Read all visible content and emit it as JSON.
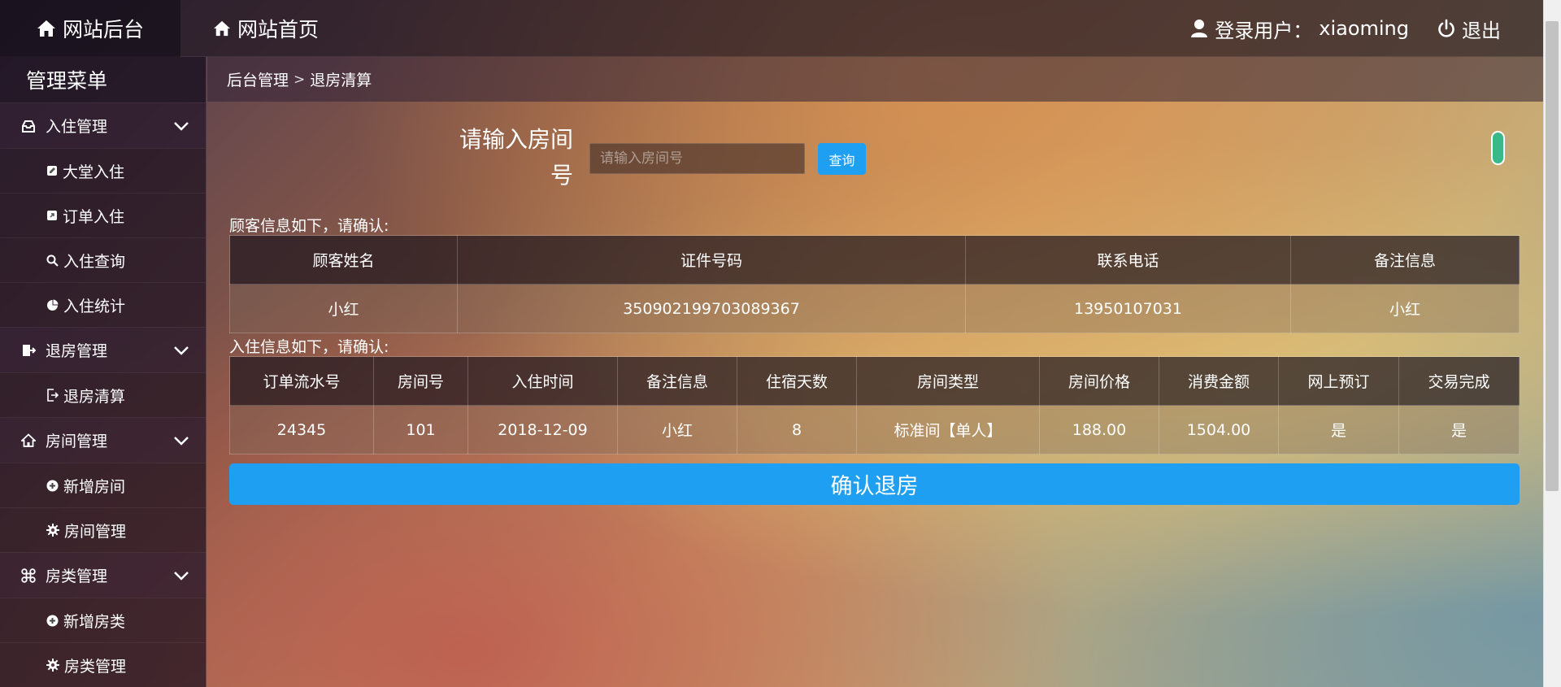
{
  "topbar": {
    "admin_tab": "网站后台",
    "home_tab": "网站首页",
    "user_label": "登录用户：",
    "username": "xiaoming",
    "logout": "退出"
  },
  "sidebar": {
    "title": "管理菜单",
    "groups": [
      {
        "label": "入住管理",
        "items": [
          {
            "label": "大堂入住"
          },
          {
            "label": "订单入住"
          },
          {
            "label": "入住查询"
          },
          {
            "label": "入住统计"
          }
        ]
      },
      {
        "label": "退房管理",
        "items": [
          {
            "label": "退房清算"
          }
        ]
      },
      {
        "label": "房间管理",
        "items": [
          {
            "label": "新增房间"
          },
          {
            "label": "房间管理"
          }
        ]
      },
      {
        "label": "房类管理",
        "items": [
          {
            "label": "新增房类"
          },
          {
            "label": "房类管理"
          }
        ]
      }
    ]
  },
  "breadcrumb": {
    "parent": "后台管理",
    "current": "退房清算"
  },
  "search": {
    "label_line1": "请输入房间",
    "label_line2": "号",
    "placeholder": "请输入房间号",
    "value": "",
    "button": "查询"
  },
  "customer": {
    "caption": "顾客信息如下，请确认:",
    "headers": [
      "顾客姓名",
      "证件号码",
      "联系电话",
      "备注信息"
    ],
    "row": [
      "小红",
      "350902199703089367",
      "13950107031",
      "小红"
    ]
  },
  "checkin": {
    "caption": "入住信息如下，请确认:",
    "headers": [
      "订单流水号",
      "房间号",
      "入住时间",
      "备注信息",
      "住宿天数",
      "房间类型",
      "房间价格",
      "消费金额",
      "网上预订",
      "交易完成"
    ],
    "row": [
      "24345",
      "101",
      "2018-12-09",
      "小红",
      "8",
      "标准间【单人】",
      "188.00",
      "1504.00",
      "是",
      "是"
    ]
  },
  "confirm_button": "确认退房",
  "colors": {
    "accent": "#1e9ff2"
  }
}
